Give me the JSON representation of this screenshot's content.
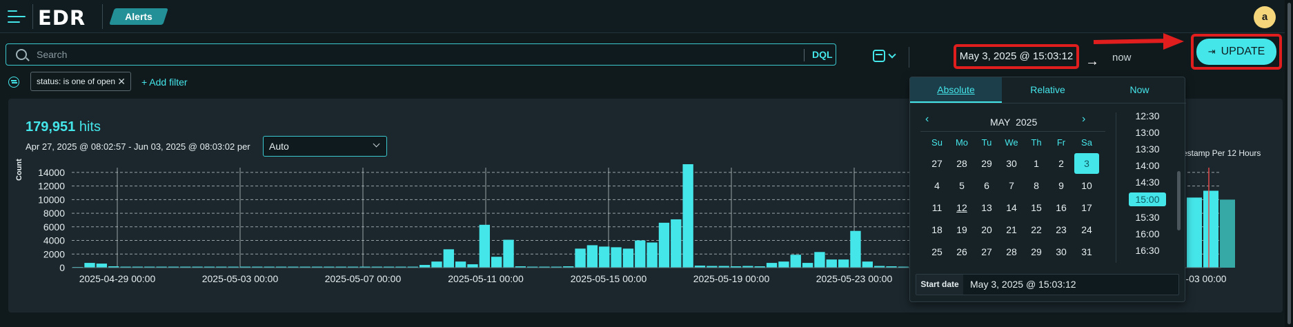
{
  "app": {
    "name": "EDR",
    "breadcrumb": "Alerts",
    "avatar_initial": "a"
  },
  "search": {
    "placeholder": "Search",
    "language": "DQL"
  },
  "time": {
    "start": "May 3, 2025 @ 15:03:12",
    "arrow": "→",
    "end": "now",
    "update_label": "UPDATE"
  },
  "filters": {
    "pill": "status: is one of open",
    "add_label": "+ Add filter"
  },
  "summary": {
    "hits_count": "179,951",
    "hits_label": "hits",
    "range": "Apr 27, 2025 @ 08:02:57 - Jun 03, 2025 @ 08:03:02 per",
    "interval": "Auto",
    "right_title": "estamp Per 12 Hours"
  },
  "picker": {
    "tabs": [
      "Absolute",
      "Relative",
      "Now"
    ],
    "month": "MAY",
    "year": "2025",
    "weekdays": [
      "Su",
      "Mo",
      "Tu",
      "We",
      "Th",
      "Fr",
      "Sa"
    ],
    "weeks": [
      [
        "27",
        "28",
        "29",
        "30",
        "1",
        "2",
        "3"
      ],
      [
        "4",
        "5",
        "6",
        "7",
        "8",
        "9",
        "10"
      ],
      [
        "11",
        "12",
        "13",
        "14",
        "15",
        "16",
        "17"
      ],
      [
        "18",
        "19",
        "20",
        "21",
        "22",
        "23",
        "24"
      ],
      [
        "25",
        "26",
        "27",
        "28",
        "29",
        "30",
        "31"
      ]
    ],
    "selected_day": "3",
    "today_day": "12",
    "times": [
      "12:30",
      "13:00",
      "13:30",
      "14:00",
      "14:30",
      "15:00",
      "15:30",
      "16:00",
      "16:30"
    ],
    "selected_time": "15:00",
    "start_label": "Start date",
    "start_value": "May 3, 2025 @ 15:03:12"
  },
  "chart_data": {
    "type": "bar",
    "ylabel": "Count",
    "ylim": [
      0,
      15000
    ],
    "yticks": [
      0,
      2000,
      4000,
      6000,
      8000,
      10000,
      12000,
      14000
    ],
    "xticks": [
      "2025-04-29 00:00",
      "2025-05-03 00:00",
      "2025-05-07 00:00",
      "2025-05-11 00:00",
      "2025-05-15 00:00",
      "2025-05-19 00:00",
      "2025-05-23 00:00",
      "-03 00:00"
    ],
    "values": [
      100,
      700,
      600,
      200,
      150,
      150,
      150,
      150,
      150,
      150,
      150,
      150,
      150,
      150,
      150,
      150,
      150,
      150,
      150,
      150,
      150,
      150,
      150,
      150,
      150,
      150,
      150,
      150,
      150,
      400,
      900,
      2700,
      900,
      500,
      6300,
      1600,
      4100,
      200,
      150,
      150,
      150,
      200,
      2800,
      3300,
      3100,
      3000,
      2800,
      4000,
      3700,
      6600,
      7100,
      15200,
      300,
      250,
      250,
      200,
      250,
      200,
      700,
      900,
      1900,
      700,
      2300,
      1200,
      1200,
      5400,
      900,
      250,
      200,
      150
    ],
    "right_values": [
      10300,
      11300,
      10000
    ],
    "color": "#45e6ea"
  }
}
